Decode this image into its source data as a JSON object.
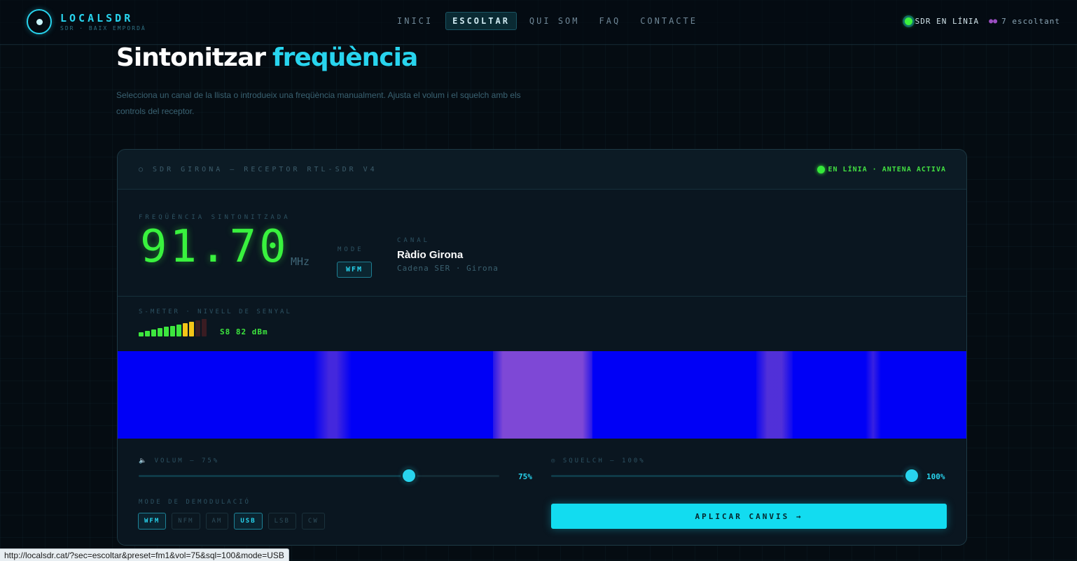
{
  "nav": {
    "brand": "LOCALSDR",
    "brand_sub": "SDR · BAIX EMPORDÀ",
    "menu": [
      {
        "label": "INICI",
        "active": false
      },
      {
        "label": "ESCOLTAR",
        "active": true
      },
      {
        "label": "QUI SOM",
        "active": false
      },
      {
        "label": "FAQ",
        "active": false
      },
      {
        "label": "CONTACTE",
        "active": false
      }
    ],
    "live_status": "SDR EN LÍNIA",
    "listeners": "7 escoltant"
  },
  "header": {
    "title": "Sintonitzar",
    "title_accent": "freqüència",
    "description": "Selecciona un canal de la llista o introdueix una freqüència manualment. Ajusta el volum i el squelch amb els controls del receptor."
  },
  "receiver": {
    "name": "○ SDR GIRONA — RECEPTOR RTL-SDR V4",
    "status": "EN LÍNIA · ANTENA ACTIVA",
    "freq_label": "FREQÜÈNCIA SINTONITZADA",
    "frequency": "91.70",
    "unit": "MHz",
    "mode_label": "MODE",
    "mode": "WFM",
    "channel_label": "CANAL",
    "channel_name": "Ràdio Girona",
    "channel_sub": "Cadena SER · Girona",
    "smeter_label": "S-METER · NIVELL DE SENYAL",
    "smeter_value": "S8   82 dBm",
    "smeter_level": 8,
    "smeter_colors": {
      "green": "#3de63e",
      "yellow": "#f5c518",
      "dim": "#3a1c22"
    }
  },
  "waterfall": {
    "background": "#0000f6",
    "signal_color": "#7c49c8"
  },
  "controls": {
    "volume_label": "🔈 VOLUM — 75%",
    "volume": 75,
    "volume_value": "75%",
    "squelch_label": "◎ SQUELCH — 100%",
    "squelch": 100,
    "squelch_value": "100%",
    "demod_label": "MODE DE DEMODULACIÓ",
    "demod_modes": [
      {
        "label": "WFM",
        "active": true
      },
      {
        "label": "NFM",
        "active": false
      },
      {
        "label": "AM",
        "active": false
      },
      {
        "label": "USB",
        "active": true
      },
      {
        "label": "LSB",
        "active": false
      },
      {
        "label": "CW",
        "active": false
      }
    ],
    "apply_label": "APLICAR CANVIS →"
  },
  "status_url": "http://localsdr.cat/?sec=escoltar&preset=fm1&vol=75&sql=100&mode=USB",
  "colors": {
    "accent": "#28d4ee",
    "green": "#39f23e",
    "background": "#050c12"
  }
}
